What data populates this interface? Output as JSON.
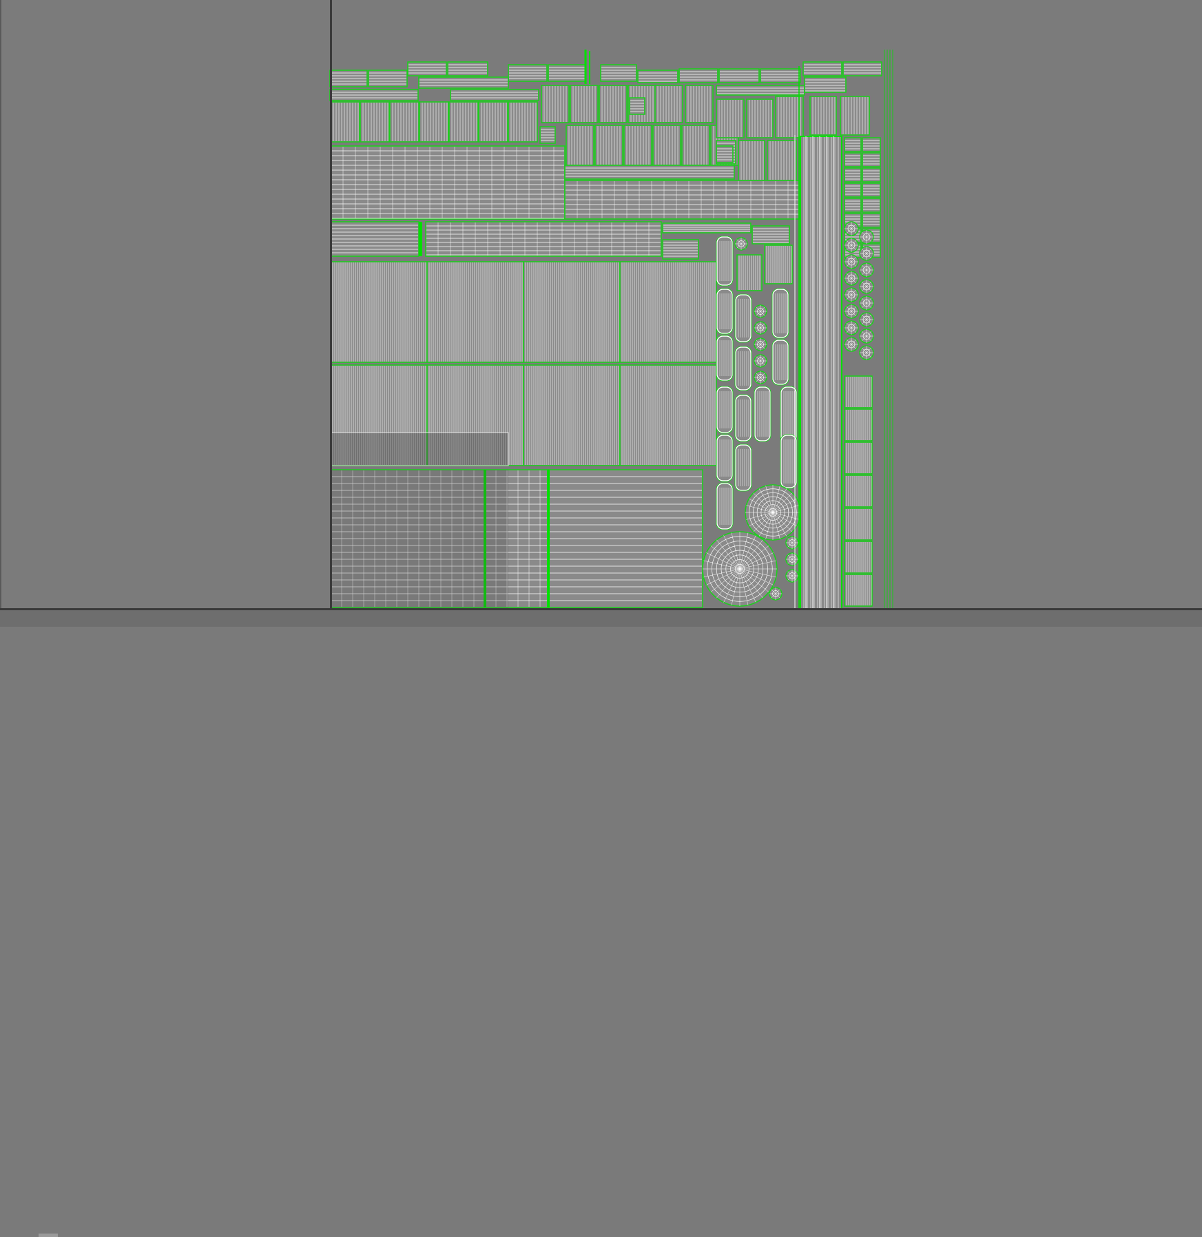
{
  "viewport": {
    "background": "#7b7b7b",
    "axis_color": "#3a3a3a"
  },
  "uv_layout": {
    "wire_color": "#ffffff",
    "border_color": "#19d119",
    "seam_color": "#00e000",
    "island_fill": "#8a8a8a"
  }
}
